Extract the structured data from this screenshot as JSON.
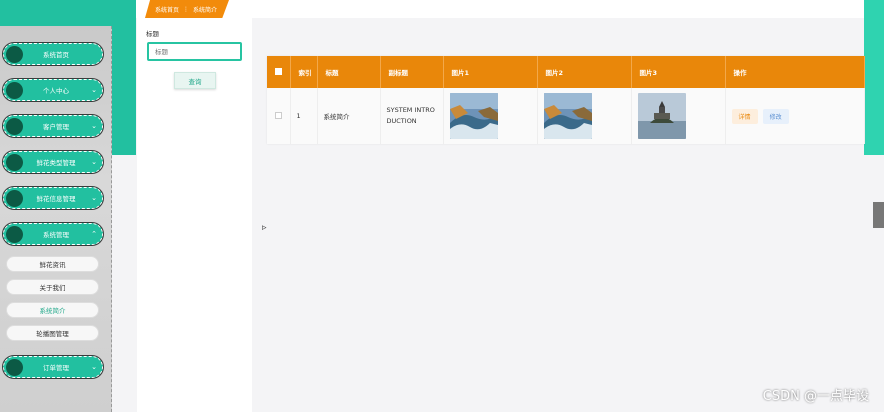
{
  "breadcrumb": {
    "home": "系统首页",
    "separator": "⋮",
    "current": "系统简介"
  },
  "sidebar": {
    "items": [
      {
        "label": "系统首页",
        "chevron": ""
      },
      {
        "label": "个人中心",
        "chevron": "⌄"
      },
      {
        "label": "客户管理",
        "chevron": "⌄"
      },
      {
        "label": "鲜花类型管理",
        "chevron": "⌄"
      },
      {
        "label": "鲜花信息管理",
        "chevron": "⌄"
      },
      {
        "label": "系统管理",
        "chevron": "⌃"
      },
      {
        "label": "订单管理",
        "chevron": "⌄"
      }
    ],
    "subitems": [
      {
        "label": "鲜花资讯"
      },
      {
        "label": "关于我们"
      },
      {
        "label": "系统简介"
      },
      {
        "label": "轮播图管理"
      }
    ]
  },
  "search": {
    "label": "标题",
    "placeholder": "标题",
    "button": "查询"
  },
  "table": {
    "headers": [
      "索引",
      "标题",
      "副标题",
      "图片1",
      "图片2",
      "图片3",
      "操作"
    ],
    "rows": [
      {
        "index": "1",
        "title": "系统简介",
        "subtitle": "SYSTEM INTRODUCTION",
        "detail": "详情",
        "edit": "修改"
      }
    ]
  },
  "watermark": "CSDN @一点毕设",
  "colors": {
    "teal": "#22c0a0",
    "orange": "#e9870a"
  }
}
